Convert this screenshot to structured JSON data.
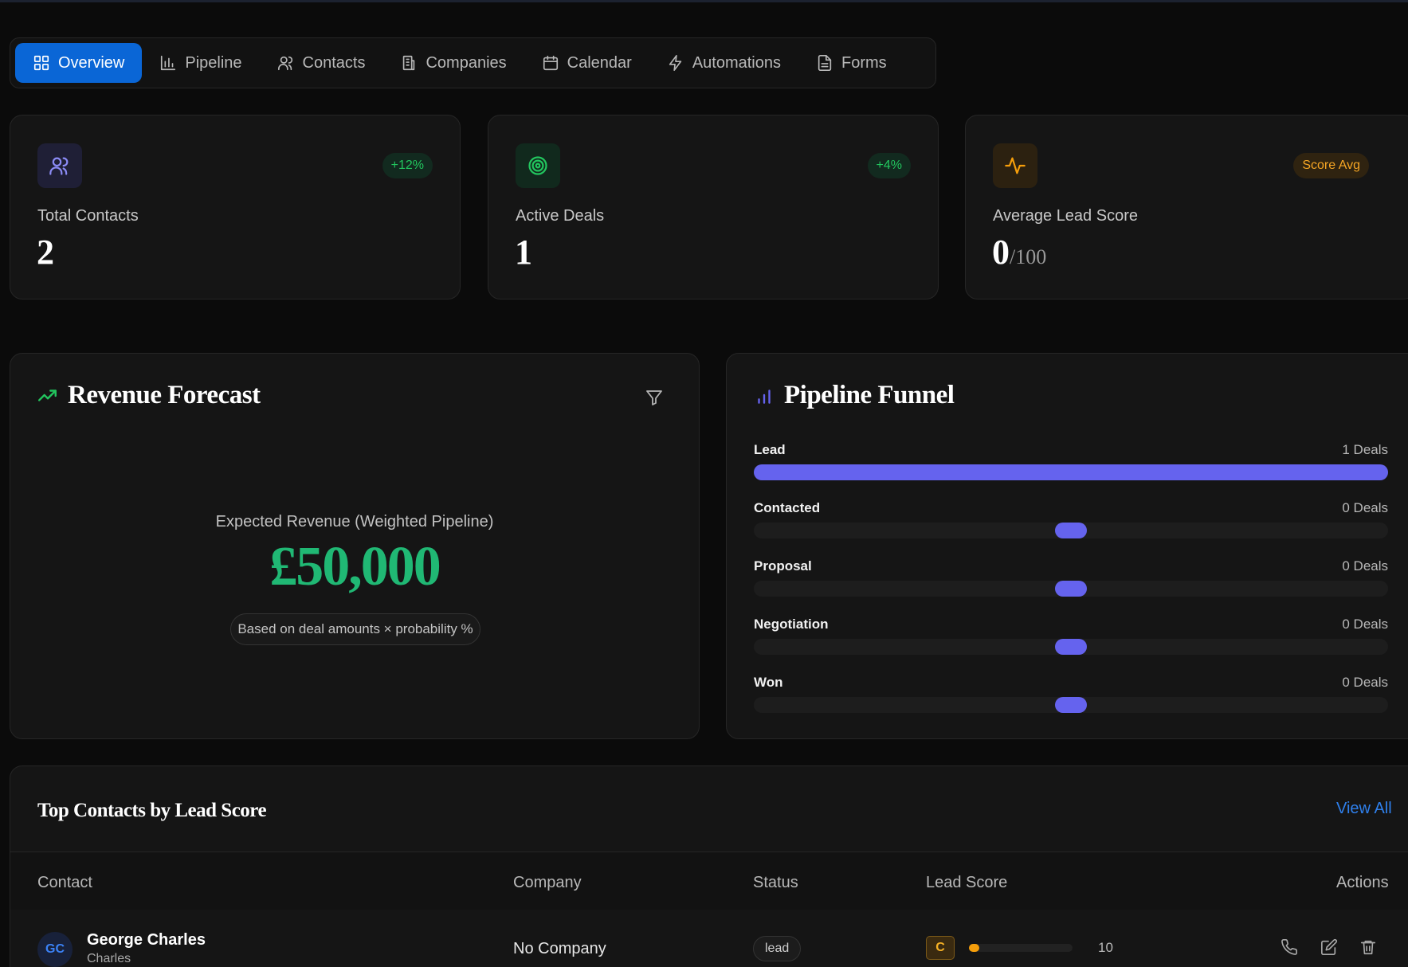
{
  "nav": {
    "tabs": [
      {
        "label": "Overview",
        "icon": "grid-icon",
        "active": true
      },
      {
        "label": "Pipeline",
        "icon": "bar-chart-icon"
      },
      {
        "label": "Contacts",
        "icon": "users-icon"
      },
      {
        "label": "Companies",
        "icon": "building-icon"
      },
      {
        "label": "Calendar",
        "icon": "calendar-icon"
      },
      {
        "label": "Automations",
        "icon": "lightning-icon"
      },
      {
        "label": "Forms",
        "icon": "document-icon"
      }
    ]
  },
  "stats": {
    "contacts": {
      "label": "Total Contacts",
      "value": "2",
      "badge": "+12%",
      "icon": "users-icon",
      "color": "#8b8bf5"
    },
    "deals": {
      "label": "Active Deals",
      "value": "1",
      "badge": "+4%",
      "icon": "target-icon",
      "color": "#22c55e"
    },
    "score": {
      "label": "Average Lead Score",
      "value": "0",
      "suffix": "/100",
      "badge": "Score Avg",
      "icon": "pulse-icon",
      "color": "#f59e0b"
    }
  },
  "revenue": {
    "title": "Revenue Forecast",
    "caption": "Expected Revenue (Weighted Pipeline)",
    "amount": "£50,000",
    "note": "Based on deal amounts × probability %"
  },
  "funnel": {
    "title": "Pipeline Funnel",
    "accent": "#6563ee",
    "stages": [
      {
        "name": "Lead",
        "count": "1 Deals",
        "deals": 1
      },
      {
        "name": "Contacted",
        "count": "0 Deals",
        "deals": 0
      },
      {
        "name": "Proposal",
        "count": "0 Deals",
        "deals": 0
      },
      {
        "name": "Negotiation",
        "count": "0 Deals",
        "deals": 0
      },
      {
        "name": "Won",
        "count": "0 Deals",
        "deals": 0
      }
    ]
  },
  "table": {
    "title": "Top Contacts by Lead Score",
    "view_all": "View All",
    "columns": [
      "Contact",
      "Company",
      "Status",
      "Lead Score",
      "Actions"
    ],
    "rows": [
      {
        "initials": "GC",
        "name": "George Charles",
        "sub": "Charles",
        "company": "No Company",
        "status": "lead",
        "grade": "C",
        "score": "10",
        "score_fraction": 0.1
      }
    ]
  }
}
